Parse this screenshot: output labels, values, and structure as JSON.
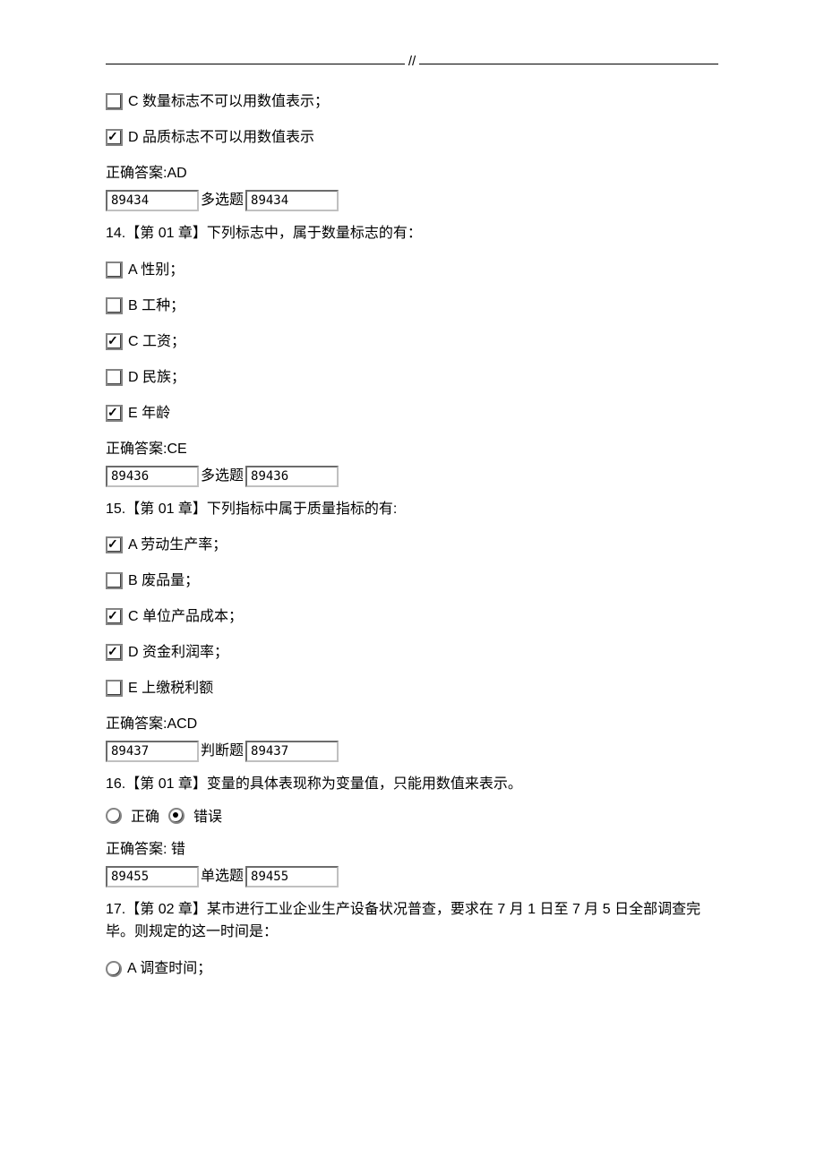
{
  "header": {
    "separator": "//"
  },
  "pre_options": {
    "C": {
      "letter": "C",
      "text": "数量标志不可以用数值表示；",
      "checked": false
    },
    "D": {
      "letter": "D",
      "text": "品质标志不可以用数值表示",
      "checked": true
    },
    "answer_label": "正确答案:AD",
    "id_left": "89434",
    "type_label": "多选题",
    "id_right": "89434"
  },
  "q14": {
    "stem": "14.【第 01 章】下列标志中，属于数量标志的有：",
    "opts": {
      "A": {
        "letter": "A",
        "text": "性别；",
        "checked": false
      },
      "B": {
        "letter": "B",
        "text": "工种；",
        "checked": false
      },
      "C": {
        "letter": "C",
        "text": "工资；",
        "checked": true
      },
      "D": {
        "letter": "D",
        "text": "民族；",
        "checked": false
      },
      "E": {
        "letter": "E",
        "text": "年龄",
        "checked": true
      }
    },
    "answer_label": "正确答案:CE",
    "id_left": "89436",
    "type_label": "多选题",
    "id_right": "89436"
  },
  "q15": {
    "stem": "15.【第 01 章】下列指标中属于质量指标的有:",
    "opts": {
      "A": {
        "letter": "A",
        "text": "劳动生产率；",
        "checked": true
      },
      "B": {
        "letter": "B",
        "text": "废品量；",
        "checked": false
      },
      "C": {
        "letter": "C",
        "text": "单位产品成本；",
        "checked": true
      },
      "D": {
        "letter": "D",
        "text": "资金利润率；",
        "checked": true
      },
      "E": {
        "letter": "E",
        "text": "上缴税利额",
        "checked": false
      }
    },
    "answer_label": "正确答案:ACD",
    "id_left": "89437",
    "type_label": "判断题",
    "id_right": "89437"
  },
  "q16": {
    "stem": "16.【第 01 章】变量的具体表现称为变量值，只能用数值来表示。",
    "true_label": "正确",
    "false_label": "错误",
    "selected": "false",
    "answer_label": "正确答案: 错",
    "id_left": "89455",
    "type_label": "单选题",
    "id_right": "89455"
  },
  "q17": {
    "stem": "17.【第 02 章】某市进行工业企业生产设备状况普查，要求在 7 月 1 日至 7 月 5 日全部调查完毕。则规定的这一时间是：",
    "opts": {
      "A": {
        "letter": "A",
        "text": "调查时间；",
        "selected": false
      }
    }
  }
}
